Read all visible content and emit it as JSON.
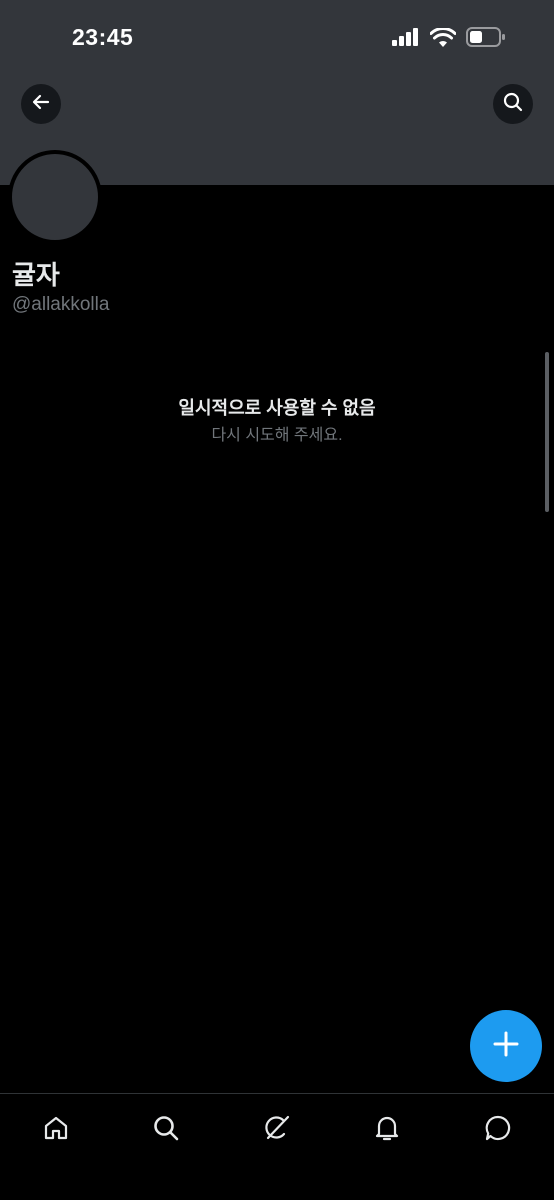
{
  "status_bar": {
    "time": "23:45",
    "signal_icon": "cellular-signal-icon",
    "wifi_icon": "wifi-icon",
    "battery_icon": "battery-icon"
  },
  "header": {
    "back_icon": "arrow-left-icon",
    "search_icon": "search-icon"
  },
  "profile": {
    "display_name": "귤자",
    "handle": "@allakkolla"
  },
  "notice": {
    "title": "일시적으로 사용할 수 없음",
    "subtitle": "다시 시도해 주세요."
  },
  "fab": {
    "icon": "plus-icon"
  },
  "tabbar": {
    "items": [
      {
        "name": "home",
        "icon": "home-icon"
      },
      {
        "name": "search",
        "icon": "search-icon"
      },
      {
        "name": "grok",
        "icon": "grok-icon"
      },
      {
        "name": "notifications",
        "icon": "bell-icon"
      },
      {
        "name": "messages",
        "icon": "message-icon"
      }
    ]
  },
  "colors": {
    "background": "#000000",
    "banner": "#33363b",
    "accent": "#1d9bf0",
    "secondary_text": "#71767b"
  }
}
